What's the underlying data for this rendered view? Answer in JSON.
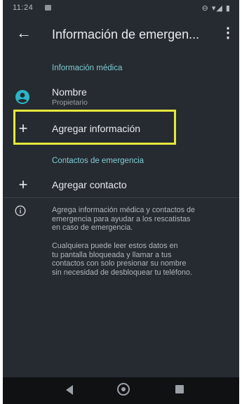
{
  "status_bar": {
    "time": "11:24",
    "indicators": "⊖ ▾◢ ▮"
  },
  "app_bar": {
    "title": "Información de emergen...",
    "back_icon": "arrow-back-icon",
    "menu_icon": "more-vert-icon"
  },
  "medical_section": {
    "header": "Información médica",
    "name_row": {
      "title": "Nombre",
      "subtitle": "Propietario"
    },
    "add_row": {
      "label": "Agregar información"
    }
  },
  "contacts_section": {
    "header": "Contactos de emergencia",
    "add_row": {
      "label": "Agregar contacto"
    }
  },
  "info": {
    "paragraph1": "Agrega información médica y contactos de\nemergencia para ayudar a los rescatistas\nen caso de emergencia.",
    "paragraph2": "Cualquiera puede leer estos datos en\ntu pantalla bloqueada y llamar a tus\ncontactos con solo presionar su nombre\nsin necesidad de desbloquear tu teléfono."
  },
  "colors": {
    "background": "#262b31",
    "accent": "#7ecbd3",
    "highlight": "#e5e83a"
  }
}
